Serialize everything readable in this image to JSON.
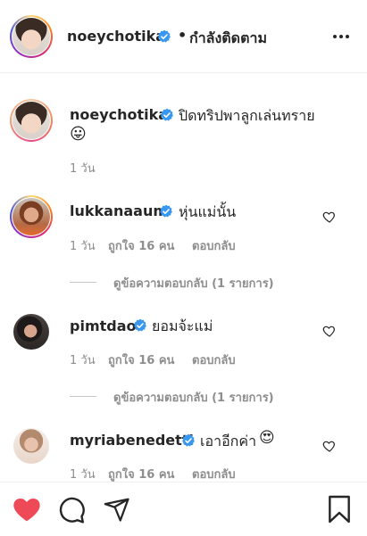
{
  "header": {
    "username": "noeychotika",
    "separator": "•",
    "follow_status": "กำลังติดตาม",
    "more_icon": "more-horizontal-icon"
  },
  "caption": {
    "username": "noeychotika",
    "text": "ปิดทริปพาลูกเล่นทราย",
    "emoji": "😛",
    "time": "1 วัน"
  },
  "comments": [
    {
      "username": "lukkanaaum",
      "text": "หุ่นแม่นั้น",
      "time": "1 วัน",
      "likes": "ถูกใจ 16 คน",
      "reply": "ตอบกลับ",
      "view_replies": "ดูข้อความตอบกลับ (1 รายการ)"
    },
    {
      "username": "pimtdao",
      "text": "ยอมจ้ะแม่",
      "time": "1 วัน",
      "likes": "ถูกใจ 16 คน",
      "reply": "ตอบกลับ",
      "view_replies": "ดูข้อความตอบกลับ (1 รายการ)"
    },
    {
      "username": "myriabenedetti",
      "text": "เอาอีกค่า",
      "emoji": "😍",
      "time": "1 วัน",
      "likes": "ถูกใจ 16 คน",
      "reply": "ตอบกลับ"
    }
  ],
  "colors": {
    "liked_heart": "#ed4956",
    "verified": "#3897f0",
    "text": "#262626",
    "muted": "#8e8e8e"
  }
}
